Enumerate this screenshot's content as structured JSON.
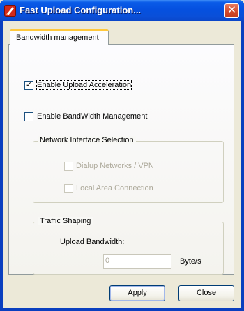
{
  "window": {
    "title": "Fast Upload Configuration...",
    "close_glyph": "✕"
  },
  "tab": {
    "label": "Bandwidth management"
  },
  "options": {
    "upload_acceleration": {
      "label": "Enable Upload Acceleration",
      "checked": true
    },
    "bandwidth_management": {
      "label": "Enable BandWidth Management",
      "checked": false
    }
  },
  "network_group": {
    "title": "Network Interface Selection",
    "items": [
      {
        "label": "Dialup Networks / VPN",
        "checked": false,
        "enabled": false
      },
      {
        "label": "Local Area Connection",
        "checked": false,
        "enabled": false
      }
    ]
  },
  "traffic_group": {
    "title": "Traffic Shaping",
    "upload_label": "Upload Bandwidth:",
    "upload_value": "0",
    "unit": "Byte/s"
  },
  "buttons": {
    "apply": "Apply",
    "close": "Close"
  },
  "check_glyph": "✓"
}
